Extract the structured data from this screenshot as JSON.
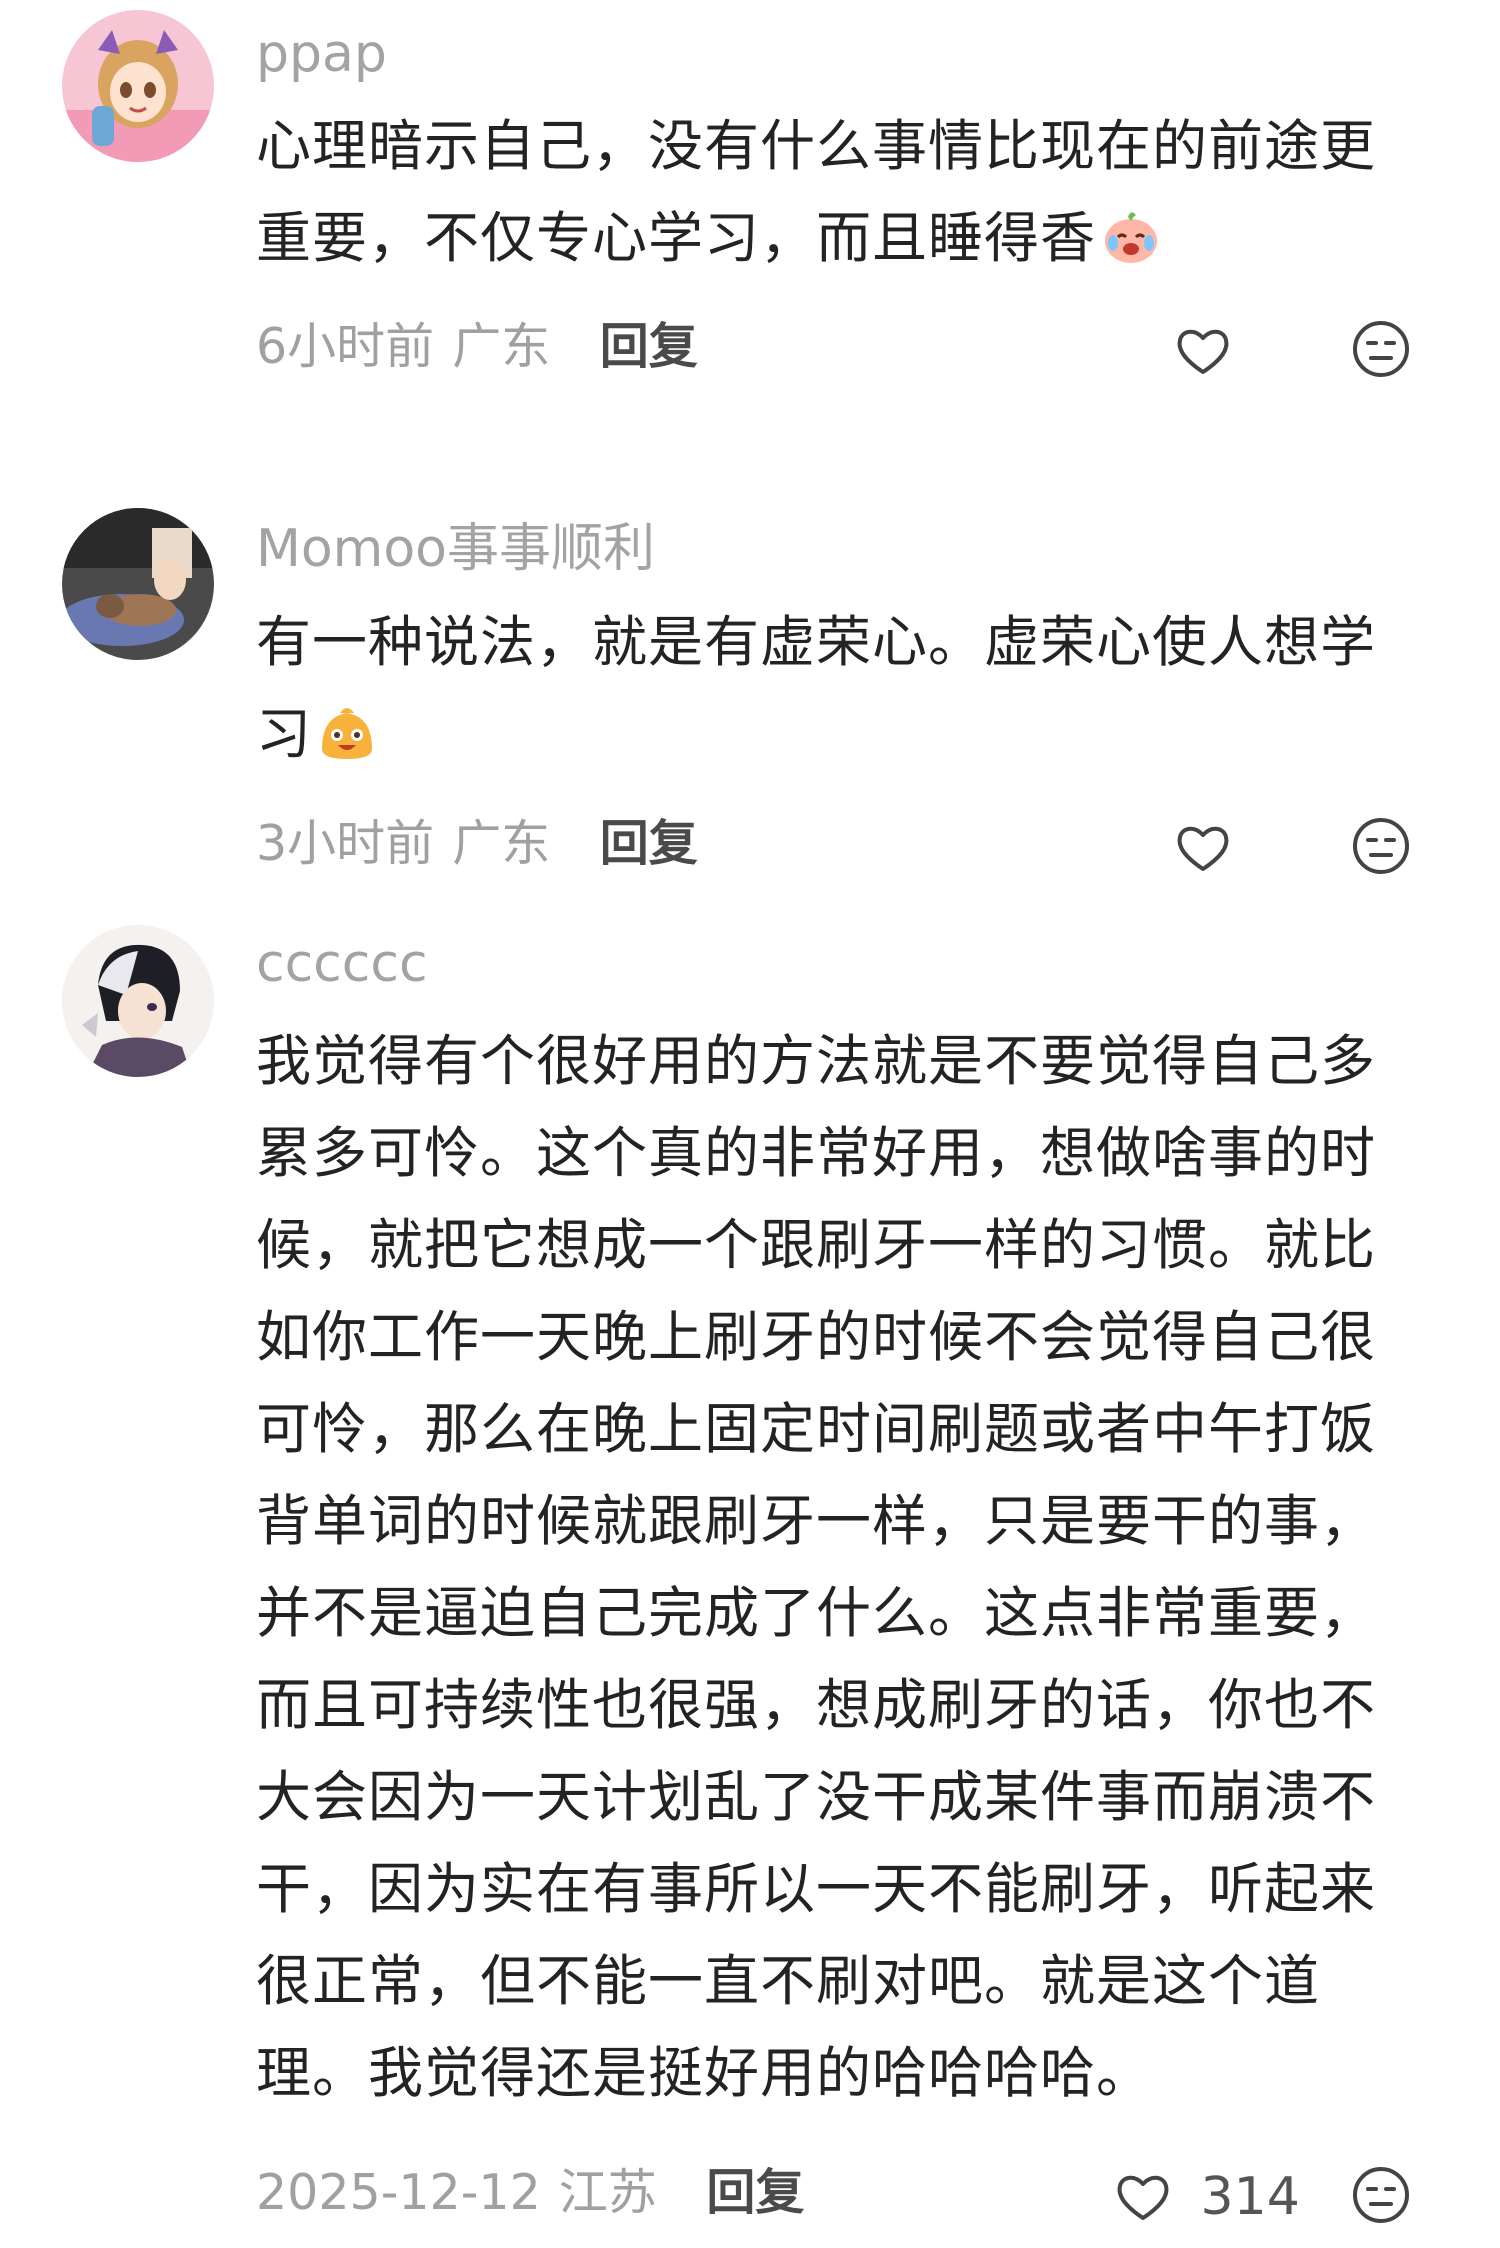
{
  "comments": [
    {
      "username": "ppap",
      "avatar_icon": "anime-girl-avatar",
      "content": "心理暗示自己，没有什么事情比现在的前途更重要，不仅专心学习，而且睡得香",
      "emoji": "crying-laughing-peach-emoji",
      "time": "6小时前",
      "location": "广东",
      "reply_label": "回复",
      "like_icon": "heart-outline-icon",
      "like_count": "",
      "dislike_icon": "neutral-face-icon"
    },
    {
      "username": "Momoo事事顺利",
      "avatar_icon": "cat-photo-avatar",
      "content": "有一种说法，就是有虚荣心。虚荣心使人想学习",
      "emoji": "grinning-bun-emoji",
      "time": "3小时前",
      "location": "广东",
      "reply_label": "回复",
      "like_icon": "heart-outline-icon",
      "like_count": "",
      "dislike_icon": "neutral-face-icon"
    },
    {
      "username": "cccccc",
      "avatar_icon": "anime-boy-avatar",
      "content": "我觉得有个很好用的方法就是不要觉得自己多累多可怜。这个真的非常好用，想做啥事的时候，就把它想成一个跟刷牙一样的习惯。就比如你工作一天晚上刷牙的时候不会觉得自己很可怜，那么在晚上固定时间刷题或者中午打饭背单词的时候就跟刷牙一样，只是要干的事，并不是逼迫自己完成了什么。这点非常重要，而且可持续性也很强，想成刷牙的话，你也不大会因为一天计划乱了没干成某件事而崩溃不干，因为实在有事所以一天不能刷牙，听起来很正常，但不能一直不刷对吧。就是这个道理。我觉得还是挺好用的哈哈哈哈。",
      "emoji": "",
      "time": "2025-12-12",
      "location": "江苏",
      "reply_label": "回复",
      "like_icon": "heart-outline-icon",
      "like_count": "314",
      "dislike_icon": "neutral-face-icon"
    }
  ]
}
